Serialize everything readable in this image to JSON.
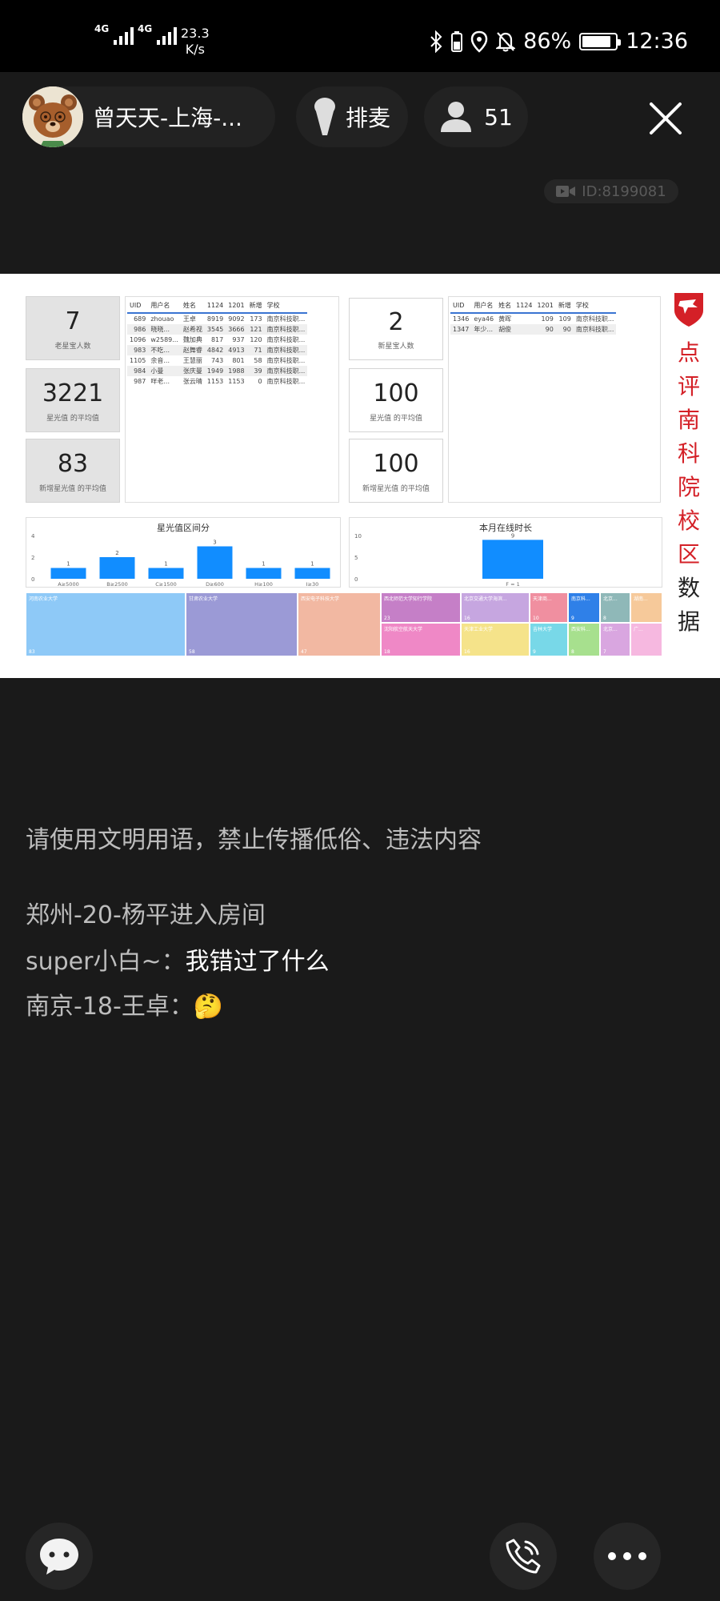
{
  "status_bar": {
    "signal_1": "4G",
    "signal_2": "4G",
    "speed_value": "23.3",
    "speed_unit": "K/s",
    "battery": "86%",
    "time": "12:36"
  },
  "header": {
    "host_name": "曾天天-上海-...",
    "queue_label": "排麦",
    "viewer_count": "51",
    "room_id": "ID:8199081"
  },
  "dashboard": {
    "side_title": [
      "点",
      "评",
      "南",
      "科",
      "院",
      "校",
      "区",
      "数",
      "据"
    ],
    "left_cards": [
      {
        "value": "7",
        "caption": "老星宝人数"
      },
      {
        "value": "3221",
        "caption": "星光值 的平均值"
      },
      {
        "value": "83",
        "caption": "新增星光值 的平均值"
      }
    ],
    "right_cards": [
      {
        "value": "2",
        "caption": "新星宝人数"
      },
      {
        "value": "100",
        "caption": "星光值 的平均值"
      },
      {
        "value": "100",
        "caption": "新增星光值 的平均值"
      }
    ],
    "table_left": {
      "headers": [
        "UID",
        "用户名",
        "姓名",
        "1124",
        "1201",
        "新增",
        "学校"
      ],
      "rows": [
        [
          "689",
          "zhouao",
          "王卓",
          "8919",
          "9092",
          "173",
          "南京科技职..."
        ],
        [
          "986",
          "晓晓...",
          "赵希视",
          "3545",
          "3666",
          "121",
          "南京科技职..."
        ],
        [
          "1096",
          "w2589...",
          "魏加典",
          "817",
          "937",
          "120",
          "南京科技职..."
        ],
        [
          "983",
          "不吃...",
          "赵舞睿",
          "4842",
          "4913",
          "71",
          "南京科技职..."
        ],
        [
          "1105",
          "余音...",
          "王慧丽",
          "743",
          "801",
          "58",
          "南京科技职..."
        ],
        [
          "984",
          "小曼",
          "张庆曼",
          "1949",
          "1988",
          "39",
          "南京科技职..."
        ],
        [
          "987",
          "咩老...",
          "张云晴",
          "1153",
          "1153",
          "0",
          "南京科技职..."
        ]
      ]
    },
    "table_right": {
      "headers": [
        "UID",
        "用户名",
        "姓名",
        "1124",
        "1201",
        "新增",
        "学校"
      ],
      "rows": [
        [
          "1346",
          "eya46",
          "黄晖",
          "",
          "109",
          "109",
          "南京科技职..."
        ],
        [
          "1347",
          "年少...",
          "胡俊",
          "",
          "90",
          "90",
          "南京科技职..."
        ]
      ]
    },
    "treemap": [
      {
        "label": "河南农业大学",
        "value": "83",
        "color": "#8ec9f7"
      },
      {
        "label": "甘肃农业大学",
        "value": "58",
        "color": "#9b9ad6"
      },
      {
        "label": "西安电子科技大学",
        "value": "47",
        "color": "#f2b8a2"
      },
      {
        "label": "西北师范大学知行学院",
        "value": "23",
        "color": "#c57fc7"
      },
      {
        "label": "北京交通大学海滨...",
        "value": "16",
        "color": "#c6a6e0"
      },
      {
        "label": "天津商...",
        "value": "10",
        "color": "#f08fa0"
      },
      {
        "label": "南京科...",
        "value": "9",
        "color": "#2f80e8"
      },
      {
        "label": "北京...",
        "value": "8",
        "color": "#8fb8b8"
      },
      {
        "label": "湖南...",
        "value": "",
        "color": "#f6c99a"
      },
      {
        "label": "沈阳航空航天大学",
        "value": "18",
        "color": "#ef88c6"
      },
      {
        "label": "天津工业大学",
        "value": "16",
        "color": "#f5e38a"
      },
      {
        "label": "吉林大学",
        "value": "9",
        "color": "#78d8e8"
      },
      {
        "label": "西安科...",
        "value": "8",
        "color": "#a7e08e"
      },
      {
        "label": "北京...",
        "value": "7",
        "color": "#d9a6e0"
      },
      {
        "label": "广...",
        "value": "",
        "color": "#f6b8e0"
      }
    ]
  },
  "chart_data": [
    {
      "type": "bar",
      "title": "星光值区间分",
      "categories": [
        "A≥5000",
        "B≥2500",
        "C≥1500",
        "D≥600",
        "H≥100",
        "I≥30"
      ],
      "values": [
        1,
        2,
        1,
        3,
        1,
        1
      ],
      "ylim": [
        0,
        4
      ],
      "yticks": [
        "0",
        "2",
        "4"
      ]
    },
    {
      "type": "bar",
      "title": "本月在线时长",
      "categories": [
        "F = 1"
      ],
      "values": [
        9
      ],
      "ylim": [
        0,
        10
      ],
      "yticks": [
        "0",
        "5",
        "10"
      ]
    }
  ],
  "chat": [
    {
      "user": "",
      "text": "请使用文明用语，禁止传播低俗、违法内容"
    },
    {
      "user": "",
      "text": "郑州-20-杨平进入房间"
    },
    {
      "user": "super小白~：",
      "text": "我错过了什么"
    },
    {
      "user": "南京-18-王卓：",
      "text": "🤔"
    }
  ]
}
